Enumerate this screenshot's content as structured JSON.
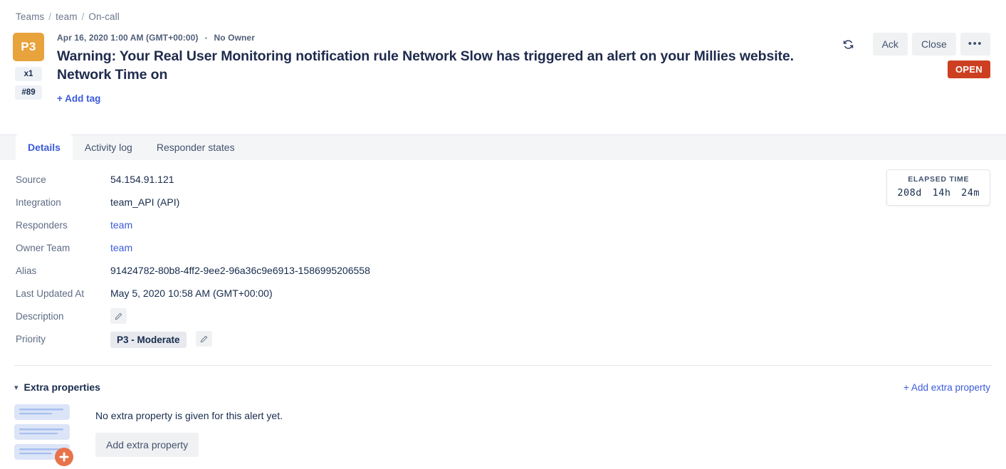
{
  "breadcrumb": {
    "items": [
      "Teams",
      "team",
      "On-call"
    ],
    "separator": "/"
  },
  "alert": {
    "priority_badge": "P3",
    "count_badge": "x1",
    "number_badge": "#89",
    "created_at": "Apr 16, 2020 1:00 AM (GMT+00:00)",
    "owner": "No Owner",
    "separator_dot": "▪",
    "title": "Warning: Your Real User Monitoring notification rule Network Slow has triggered an alert on your Millies website. Network Time on",
    "add_tag_label": "+ Add tag",
    "status": "OPEN"
  },
  "actions": {
    "refresh_icon": "refresh-icon",
    "ack_label": "Ack",
    "close_label": "Close",
    "more_label": "•••"
  },
  "tabs": [
    {
      "label": "Details",
      "active": true
    },
    {
      "label": "Activity log",
      "active": false
    },
    {
      "label": "Responder states",
      "active": false
    }
  ],
  "details": [
    {
      "label": "Source",
      "value": "54.154.91.121",
      "kind": "text"
    },
    {
      "label": "Integration",
      "value": "team_API (API)",
      "kind": "text"
    },
    {
      "label": "Responders",
      "value": "team",
      "kind": "link"
    },
    {
      "label": "Owner Team",
      "value": "team",
      "kind": "link"
    },
    {
      "label": "Alias",
      "value": "91424782-80b8-4ff2-9ee2-96a36c9e6913-1586995206558",
      "kind": "text"
    },
    {
      "label": "Last Updated At",
      "value": "May 5, 2020 10:58 AM (GMT+00:00)",
      "kind": "text"
    },
    {
      "label": "Description",
      "value": "",
      "kind": "edit"
    },
    {
      "label": "Priority",
      "value": "P3 - Moderate",
      "kind": "chip-edit"
    }
  ],
  "elapsed_time": {
    "title": "ELAPSED TIME",
    "days": "208d",
    "hours": "14h",
    "minutes": "24m"
  },
  "extra_properties": {
    "section_title": "Extra properties",
    "chevron_icon": "chevron-down-icon",
    "add_link_label": "+ Add extra property",
    "empty_message": "No extra property is given for this alert yet.",
    "add_button_label": "Add extra property"
  },
  "colors": {
    "priority_amber": "#E8A33D",
    "status_red": "#CC3F21",
    "link_blue": "#3B5BDB",
    "text_dark": "#172B4D",
    "muted": "#5E6C84",
    "illus_blue": "#DCE5F7",
    "illus_orange": "#E8734A"
  }
}
